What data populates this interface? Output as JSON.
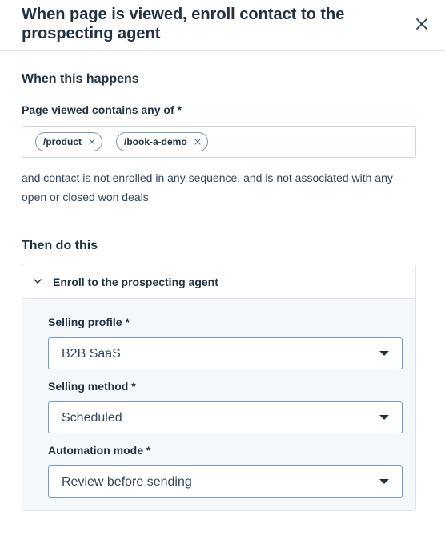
{
  "header": {
    "title": "When page is viewed, enroll contact to the prospecting agent",
    "close_icon": "close-icon"
  },
  "trigger": {
    "heading": "When this happens",
    "field_label": "Page viewed contains any of *",
    "tags": [
      {
        "label": "/product"
      },
      {
        "label": "/book-a-demo"
      }
    ],
    "condition_text": "and contact is not enrolled in any sequence, and is not associated with any open or closed won deals"
  },
  "action": {
    "heading": "Then do this",
    "card_title": "Enroll to the prospecting agent",
    "chevron_icon": "chevron-down-icon",
    "fields": [
      {
        "label": "Selling profile *",
        "value": "B2B SaaS"
      },
      {
        "label": "Selling method *",
        "value": "Scheduled"
      },
      {
        "label": "Automation mode *",
        "value": "Review before sending"
      }
    ]
  },
  "colors": {
    "heading_text": "#213343",
    "body_text": "#33475b",
    "border": "#dfe3eb",
    "input_border": "#7c98b6",
    "card_body_bg": "#f5f8fa"
  }
}
